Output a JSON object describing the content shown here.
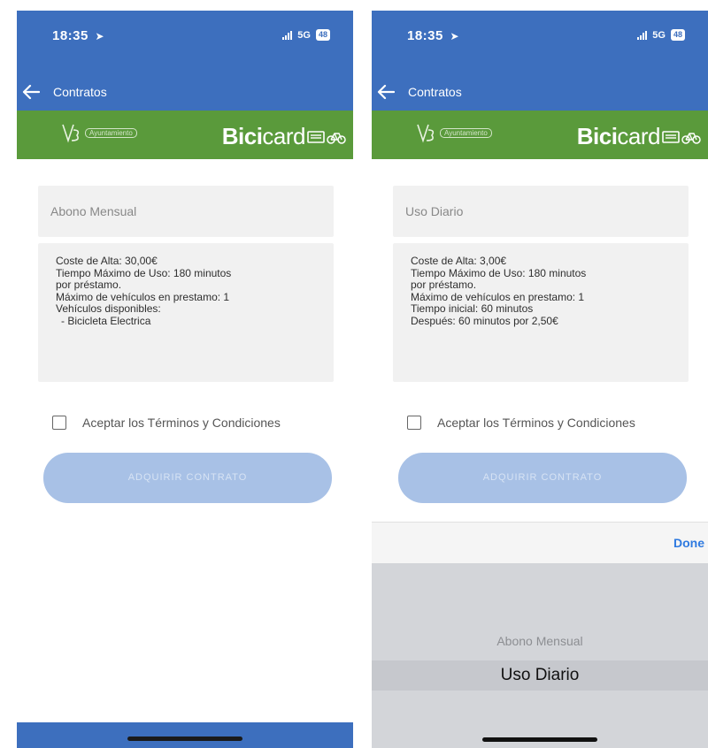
{
  "colors": {
    "header_blue": "#3d6fbe",
    "brand_green": "#5a9a3b",
    "cta_disabled": "#a8c1e6",
    "done_blue": "#2f7ae0",
    "picker_bg": "#d3d5d9"
  },
  "icons": {
    "back": "arrow-left-icon",
    "location": "location-arrow-icon",
    "signal": "signal-bars-icon",
    "battery": "battery-icon",
    "bike": "bicycle-icon",
    "card": "card-icon"
  },
  "screens": [
    {
      "status": {
        "time": "18:35",
        "network": "5G",
        "battery": "48"
      },
      "nav": {
        "title": "Contratos"
      },
      "brand": {
        "logo_small": "Ҁ.",
        "logo_small_sub": "Ayuntamiento",
        "logo_bici": "Bici",
        "logo_card": "card"
      },
      "plan_select": {
        "value": "Abono Mensual"
      },
      "details": [
        "Coste de Alta: 30,00€",
        "Tiempo Máximo de Uso: 180 minutos",
        "por préstamo.",
        "Máximo de vehículos en prestamo: 1",
        "Vehículos disponibles:",
        "- Bicicleta Electrica"
      ],
      "terms_label": "Aceptar los Términos y Condiciones",
      "cta_label": "ADQUIRIR CONTRATO"
    },
    {
      "status": {
        "time": "18:35",
        "network": "5G",
        "battery": "48"
      },
      "nav": {
        "title": "Contratos"
      },
      "brand": {
        "logo_small": "Ҁ.",
        "logo_small_sub": "Ayuntamiento",
        "logo_bici": "Bici",
        "logo_card": "card"
      },
      "plan_select": {
        "value": "Uso Diario"
      },
      "details": [
        "Coste de Alta: 3,00€",
        "Tiempo Máximo de Uso: 180 minutos",
        "por préstamo.",
        "Máximo de vehículos en prestamo: 1",
        "Tiempo inicial: 60 minutos",
        "Después: 60 minutos por 2,50€"
      ],
      "terms_label": "Aceptar los Términos y Condiciones",
      "cta_label": "ADQUIRIR CONTRATO",
      "picker": {
        "done_label": "Done",
        "options": [
          "Abono Mensual",
          "Uso Diario"
        ],
        "selected": "Uso Diario"
      }
    }
  ]
}
